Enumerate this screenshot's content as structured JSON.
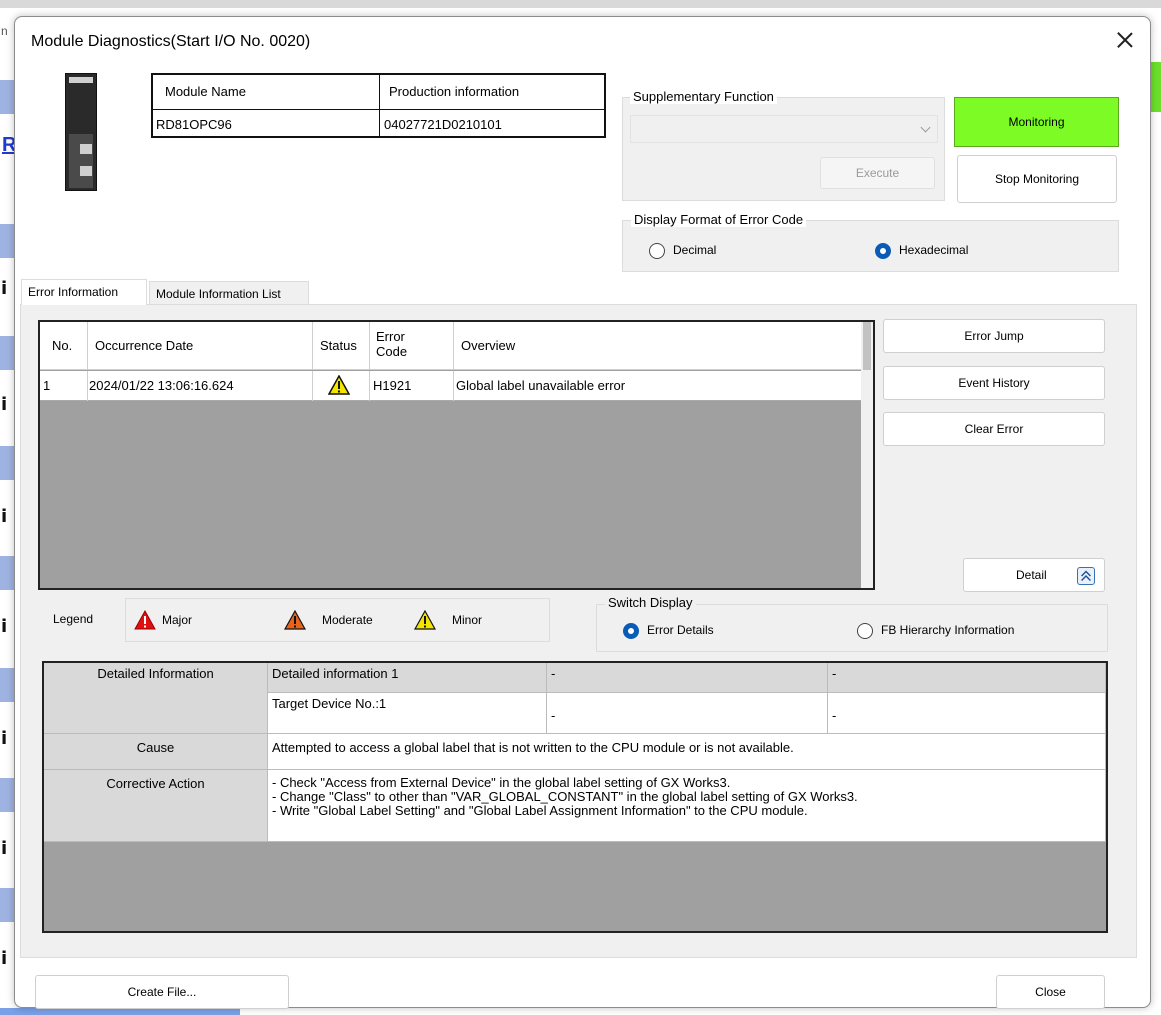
{
  "window": {
    "title": "Module Diagnostics(Start I/O No. 0020)"
  },
  "module_table": {
    "headers": [
      "Module Name",
      "Production information"
    ],
    "values": [
      "RD81OPC96",
      "04027721D0210101"
    ]
  },
  "supplementary": {
    "label": "Supplementary Function",
    "selected": "",
    "execute_label": "Execute"
  },
  "monitoring": {
    "monitoring_label": "Monitoring",
    "stop_label": "Stop Monitoring",
    "monitoring_color": "#7cfc24"
  },
  "error_format": {
    "label": "Display Format of Error Code",
    "options": [
      "Decimal",
      "Hexadecimal"
    ],
    "selected": "Hexadecimal"
  },
  "tabs": [
    "Error Information",
    "Module Information List"
  ],
  "error_table": {
    "headers": {
      "no": "No.",
      "date": "Occurrence Date",
      "status": "Status",
      "code": "Error Code",
      "overview": "Overview"
    },
    "rows": [
      {
        "no": "1",
        "date": "2024/01/22 13:06:16.624",
        "status": "minor-warning-icon",
        "code": "H1921",
        "overview": "Global label unavailable error"
      }
    ]
  },
  "side_buttons": {
    "error_jump": "Error Jump",
    "event_history": "Event History",
    "clear_error": "Clear Error",
    "detail": "Detail"
  },
  "legend": {
    "label": "Legend",
    "items": [
      {
        "label": "Major",
        "color": "#e01010"
      },
      {
        "label": "Moderate",
        "color": "#e8641a"
      },
      {
        "label": "Minor",
        "color": "#f2e600"
      }
    ]
  },
  "switch_display": {
    "label": "Switch Display",
    "options": [
      "Error Details",
      "FB Hierarchy Information"
    ],
    "selected": "Error Details"
  },
  "detail_table": {
    "detailed_info_label": "Detailed Information",
    "detailed_info_1": "Detailed information 1",
    "detailed_info_1_value": "Target Device No.:1",
    "dash": "-",
    "cause_label": "Cause",
    "cause": "Attempted to access a global label that is not written to the CPU module or is not available.",
    "corrective_label": "Corrective Action",
    "corrective_lines": [
      "- Check \"Access from External Device\" in the global label setting of GX Works3.",
      "- Change \"Class\" to other than \"VAR_GLOBAL_CONSTANT\" in the global label setting of GX Works3.",
      "- Write \"Global Label Setting\" and \"Global Label Assignment Information\" to the CPU module."
    ]
  },
  "footer": {
    "create_file": "Create File...",
    "close": "Close"
  }
}
